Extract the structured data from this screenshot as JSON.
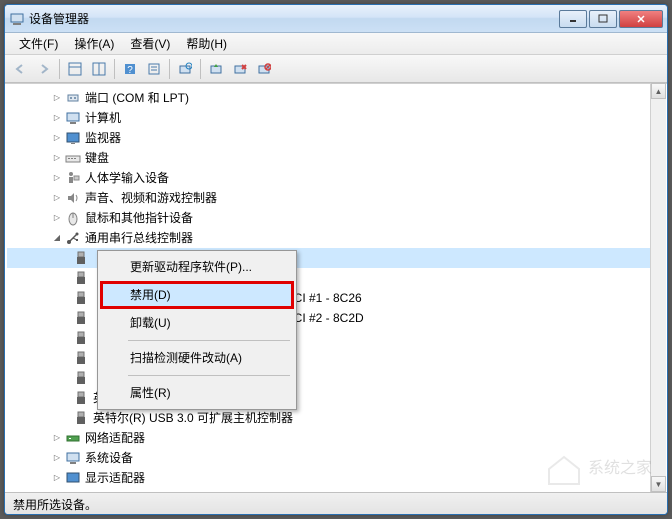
{
  "window": {
    "title": "设备管理器"
  },
  "menubar": {
    "file": "文件(F)",
    "action": "操作(A)",
    "view": "查看(V)",
    "help": "帮助(H)"
  },
  "tree": {
    "ports": "端口 (COM 和 LPT)",
    "computer": "计算机",
    "monitor": "监视器",
    "keyboard": "键盘",
    "hid": "人体学输入设备",
    "sound": "声音、视频和游戏控制器",
    "mouse": "鼠标和其他指针设备",
    "usb": "通用串行总线控制器",
    "usb_items": [
      "",
      "",
      "HCI #1 - 8C26",
      "HCI #2 - 8C2D",
      "",
      "",
      "",
      "英特尔(R) USB 3.0 根集线器",
      "英特尔(R) USB 3.0 可扩展主机控制器"
    ],
    "network": "网络适配器",
    "system": "系统设备",
    "display": "显示适配器"
  },
  "context": {
    "update": "更新驱动程序软件(P)...",
    "disable": "禁用(D)",
    "uninstall": "卸载(U)",
    "scan": "扫描检测硬件改动(A)",
    "properties": "属性(R)"
  },
  "status": "禁用所选设备。",
  "watermark": "系统之家"
}
